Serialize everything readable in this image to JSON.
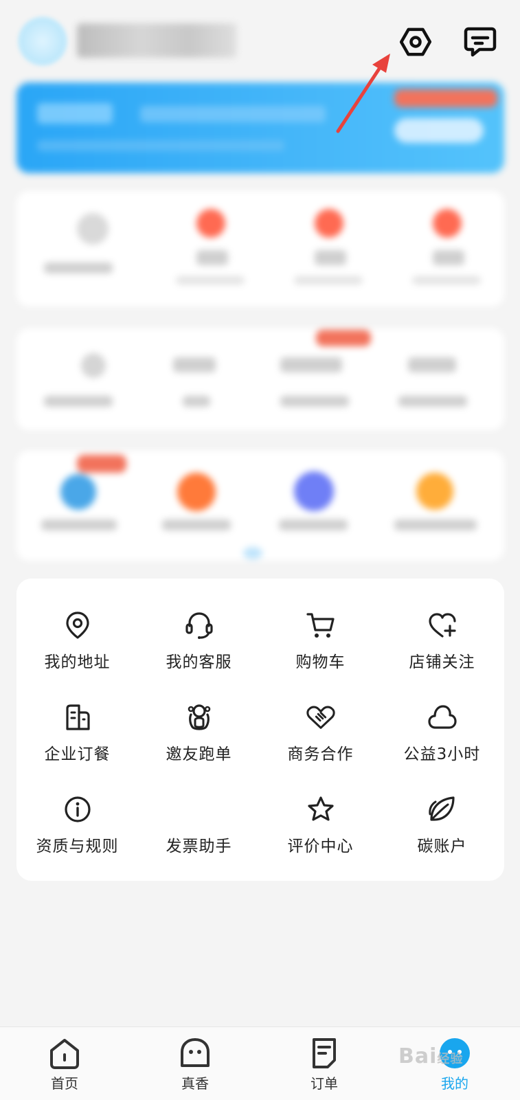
{
  "header": {
    "settings_icon": "settings-hex-icon",
    "message_icon": "message-bubble-icon",
    "arrow_color": "#e8423c"
  },
  "menu": {
    "items": [
      {
        "label": "我的地址",
        "icon": "location-pin-icon"
      },
      {
        "label": "我的客服",
        "icon": "headset-icon"
      },
      {
        "label": "购物车",
        "icon": "cart-icon"
      },
      {
        "label": "店铺关注",
        "icon": "heart-plus-icon"
      },
      {
        "label": "企业订餐",
        "icon": "building-icon"
      },
      {
        "label": "邀友跑单",
        "icon": "rider-icon"
      },
      {
        "label": "商务合作",
        "icon": "handshake-icon"
      },
      {
        "label": "公益3小时",
        "icon": "cloud-icon"
      },
      {
        "label": "资质与规则",
        "icon": "info-icon"
      },
      {
        "label": "发票助手",
        "icon": "invoice-icon"
      },
      {
        "label": "评价中心",
        "icon": "star-icon"
      },
      {
        "label": "碳账户",
        "icon": "leaf-icon"
      }
    ]
  },
  "nav": {
    "items": [
      {
        "label": "首页",
        "icon": "home-icon"
      },
      {
        "label": "真香",
        "icon": "ghost-icon"
      },
      {
        "label": "订单",
        "icon": "order-icon"
      },
      {
        "label": "我的",
        "icon": "profile-icon"
      }
    ],
    "active_color": "#19a6ee"
  },
  "watermark": {
    "text": "Bai",
    "suffix": "经验"
  }
}
